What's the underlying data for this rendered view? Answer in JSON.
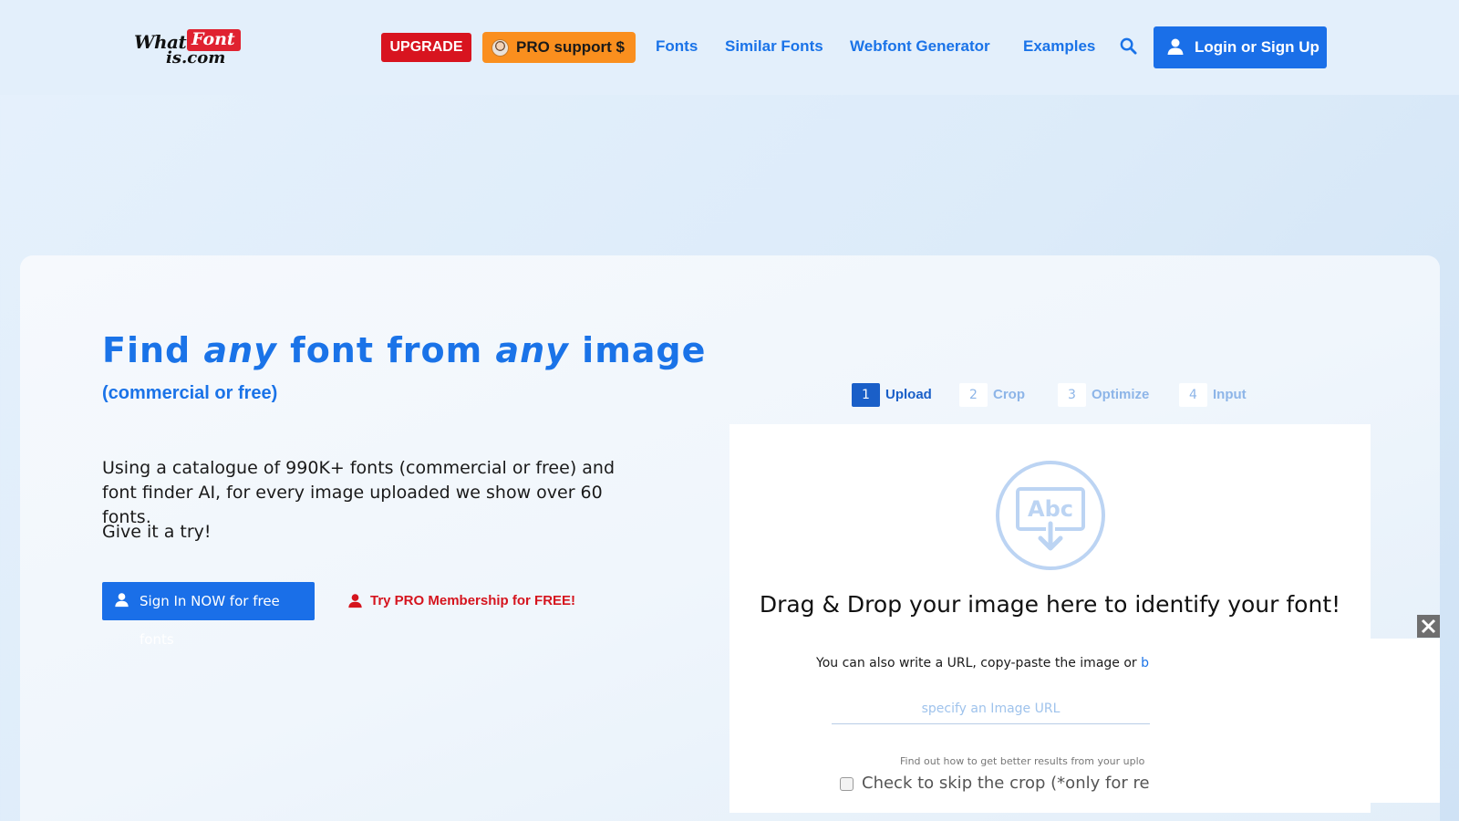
{
  "header": {
    "logo": {
      "word1": "What",
      "word2": "Font",
      "word3": "is.com"
    },
    "upgrade_label": "UPGRADE",
    "pro_support_label": "PRO support $",
    "nav": [
      {
        "label": "Fonts"
      },
      {
        "label": "Similar Fonts"
      },
      {
        "label": "Webfont Generator"
      },
      {
        "label": "Examples"
      }
    ],
    "search_icon": "search-icon",
    "login_label": "Login or Sign Up"
  },
  "hero": {
    "title_part1": "Find ",
    "title_any1": "any",
    "title_part2": " font from ",
    "title_any2": "any",
    "title_part3": " image",
    "subtitle": "(commercial or free)",
    "description": "Using a catalogue of 990K+ fonts (commercial or free) and font finder AI, for every image uploaded we show over 60 fonts.",
    "try_text": "Give it a try!",
    "signin_label": "Sign In NOW for free fonts",
    "trypro_label": "Try PRO Membership for FREE!"
  },
  "steps": [
    {
      "num": "1",
      "label": "Upload",
      "active": true
    },
    {
      "num": "2",
      "label": "Crop",
      "active": false
    },
    {
      "num": "3",
      "label": "Optimize",
      "active": false
    },
    {
      "num": "4",
      "label": "Input",
      "active": false
    }
  ],
  "upload": {
    "icon_text": "Abc",
    "drop_title": "Drag & Drop your image here to identify your font!",
    "url_line_text": "You can also write a URL, copy-paste the image or ",
    "url_line_link": "br",
    "url_placeholder": "specify an Image URL",
    "hint": "Find out how to get better results from your uplo",
    "skip_label": "Check to skip the crop (*only for reg"
  },
  "colors": {
    "accent": "#1a73e8",
    "upgrade": "#d8141f",
    "pro_support": "#fa8f1e",
    "background": "#e3effb"
  }
}
